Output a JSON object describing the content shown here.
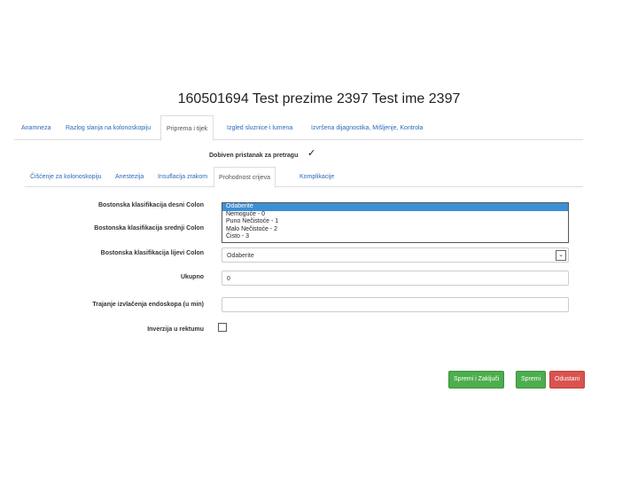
{
  "page_title": "160501694 Test prezime 2397 Test ime 2397",
  "main_tabs": [
    {
      "label": "Anamneza"
    },
    {
      "label": "Razlog slanja na kolonoskopiju"
    },
    {
      "label": "Priprema i tijek"
    },
    {
      "label": "Izgled sluznice i lumena"
    },
    {
      "label": "Izvršena dijagnostika, Mišljenje, Kontrola"
    }
  ],
  "dobiven": {
    "label": "Dobiven pristanak za pretragu",
    "checked": true,
    "mark": "✓"
  },
  "sub_tabs": [
    {
      "label": "Čišćenje za kolonoskopiju"
    },
    {
      "label": "Anestezija"
    },
    {
      "label": "Insuflacija zrakom"
    },
    {
      "label": "Prohodnost crijeva"
    },
    {
      "label": "Komplikacije"
    }
  ],
  "fields": {
    "desni_label": "Bostonska klasifikacija desni Colon",
    "srednji_label": "Bostonska klasifikacija srednji Colon",
    "lijevi_label": "Bostonska klasifikacija lijevi Colon",
    "lijevi_value": "Odaberite",
    "ukupno_label": "Ukupno",
    "ukupno_value": "0",
    "trajanje_label": "Trajanje izvlačenja endoskopa (u min)",
    "trajanje_value": "",
    "inverzija_label": "Inverzija u rektumu"
  },
  "dropdown_options": [
    "Odaberite",
    "Nemoguće - 0",
    "Puno Nečistoće - 1",
    "Malo Nečistoće - 2",
    "Čisto - 3"
  ],
  "dropdown_selected": "Odaberite",
  "buttons": {
    "save_close": "Spremi i Zaključi",
    "save": "Spremi",
    "cancel": "Odustani"
  },
  "colors": {
    "primary": "#4cae4c",
    "danger": "#d9534f",
    "link": "#2a6ab8",
    "selected": "#3c8fd6"
  }
}
